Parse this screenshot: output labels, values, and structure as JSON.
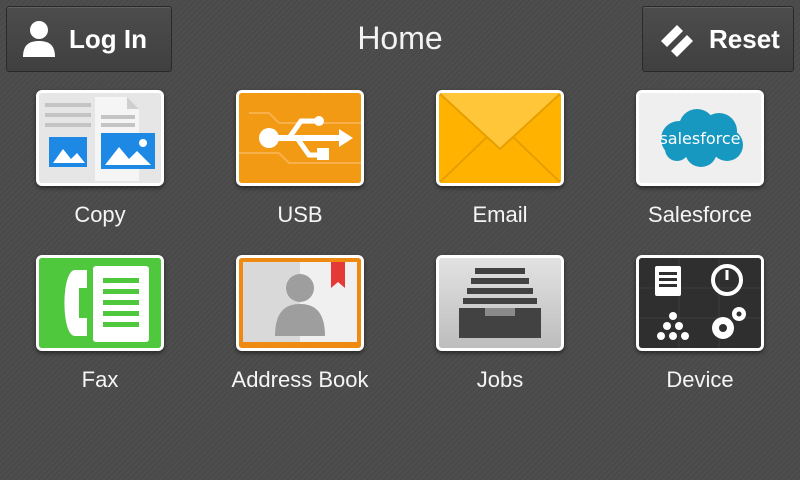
{
  "header": {
    "title": "Home",
    "login_label": "Log In",
    "reset_label": "Reset"
  },
  "apps": [
    {
      "label": "Copy",
      "icon": "copy-icon"
    },
    {
      "label": "USB",
      "icon": "usb-icon"
    },
    {
      "label": "Email",
      "icon": "email-icon"
    },
    {
      "label": "Salesforce",
      "icon": "salesforce-icon",
      "logo_text": "salesforce"
    },
    {
      "label": "Fax",
      "icon": "fax-icon"
    },
    {
      "label": "Address Book",
      "icon": "address-book-icon"
    },
    {
      "label": "Jobs",
      "icon": "jobs-icon"
    },
    {
      "label": "Device",
      "icon": "device-icon"
    }
  ],
  "colors": {
    "background": "#4a4a4a",
    "usb": "#f0900c",
    "email": "#ffb400",
    "salesforce": "#1798c1",
    "fax": "#4cc83c",
    "address_book": "#ee8a12"
  }
}
